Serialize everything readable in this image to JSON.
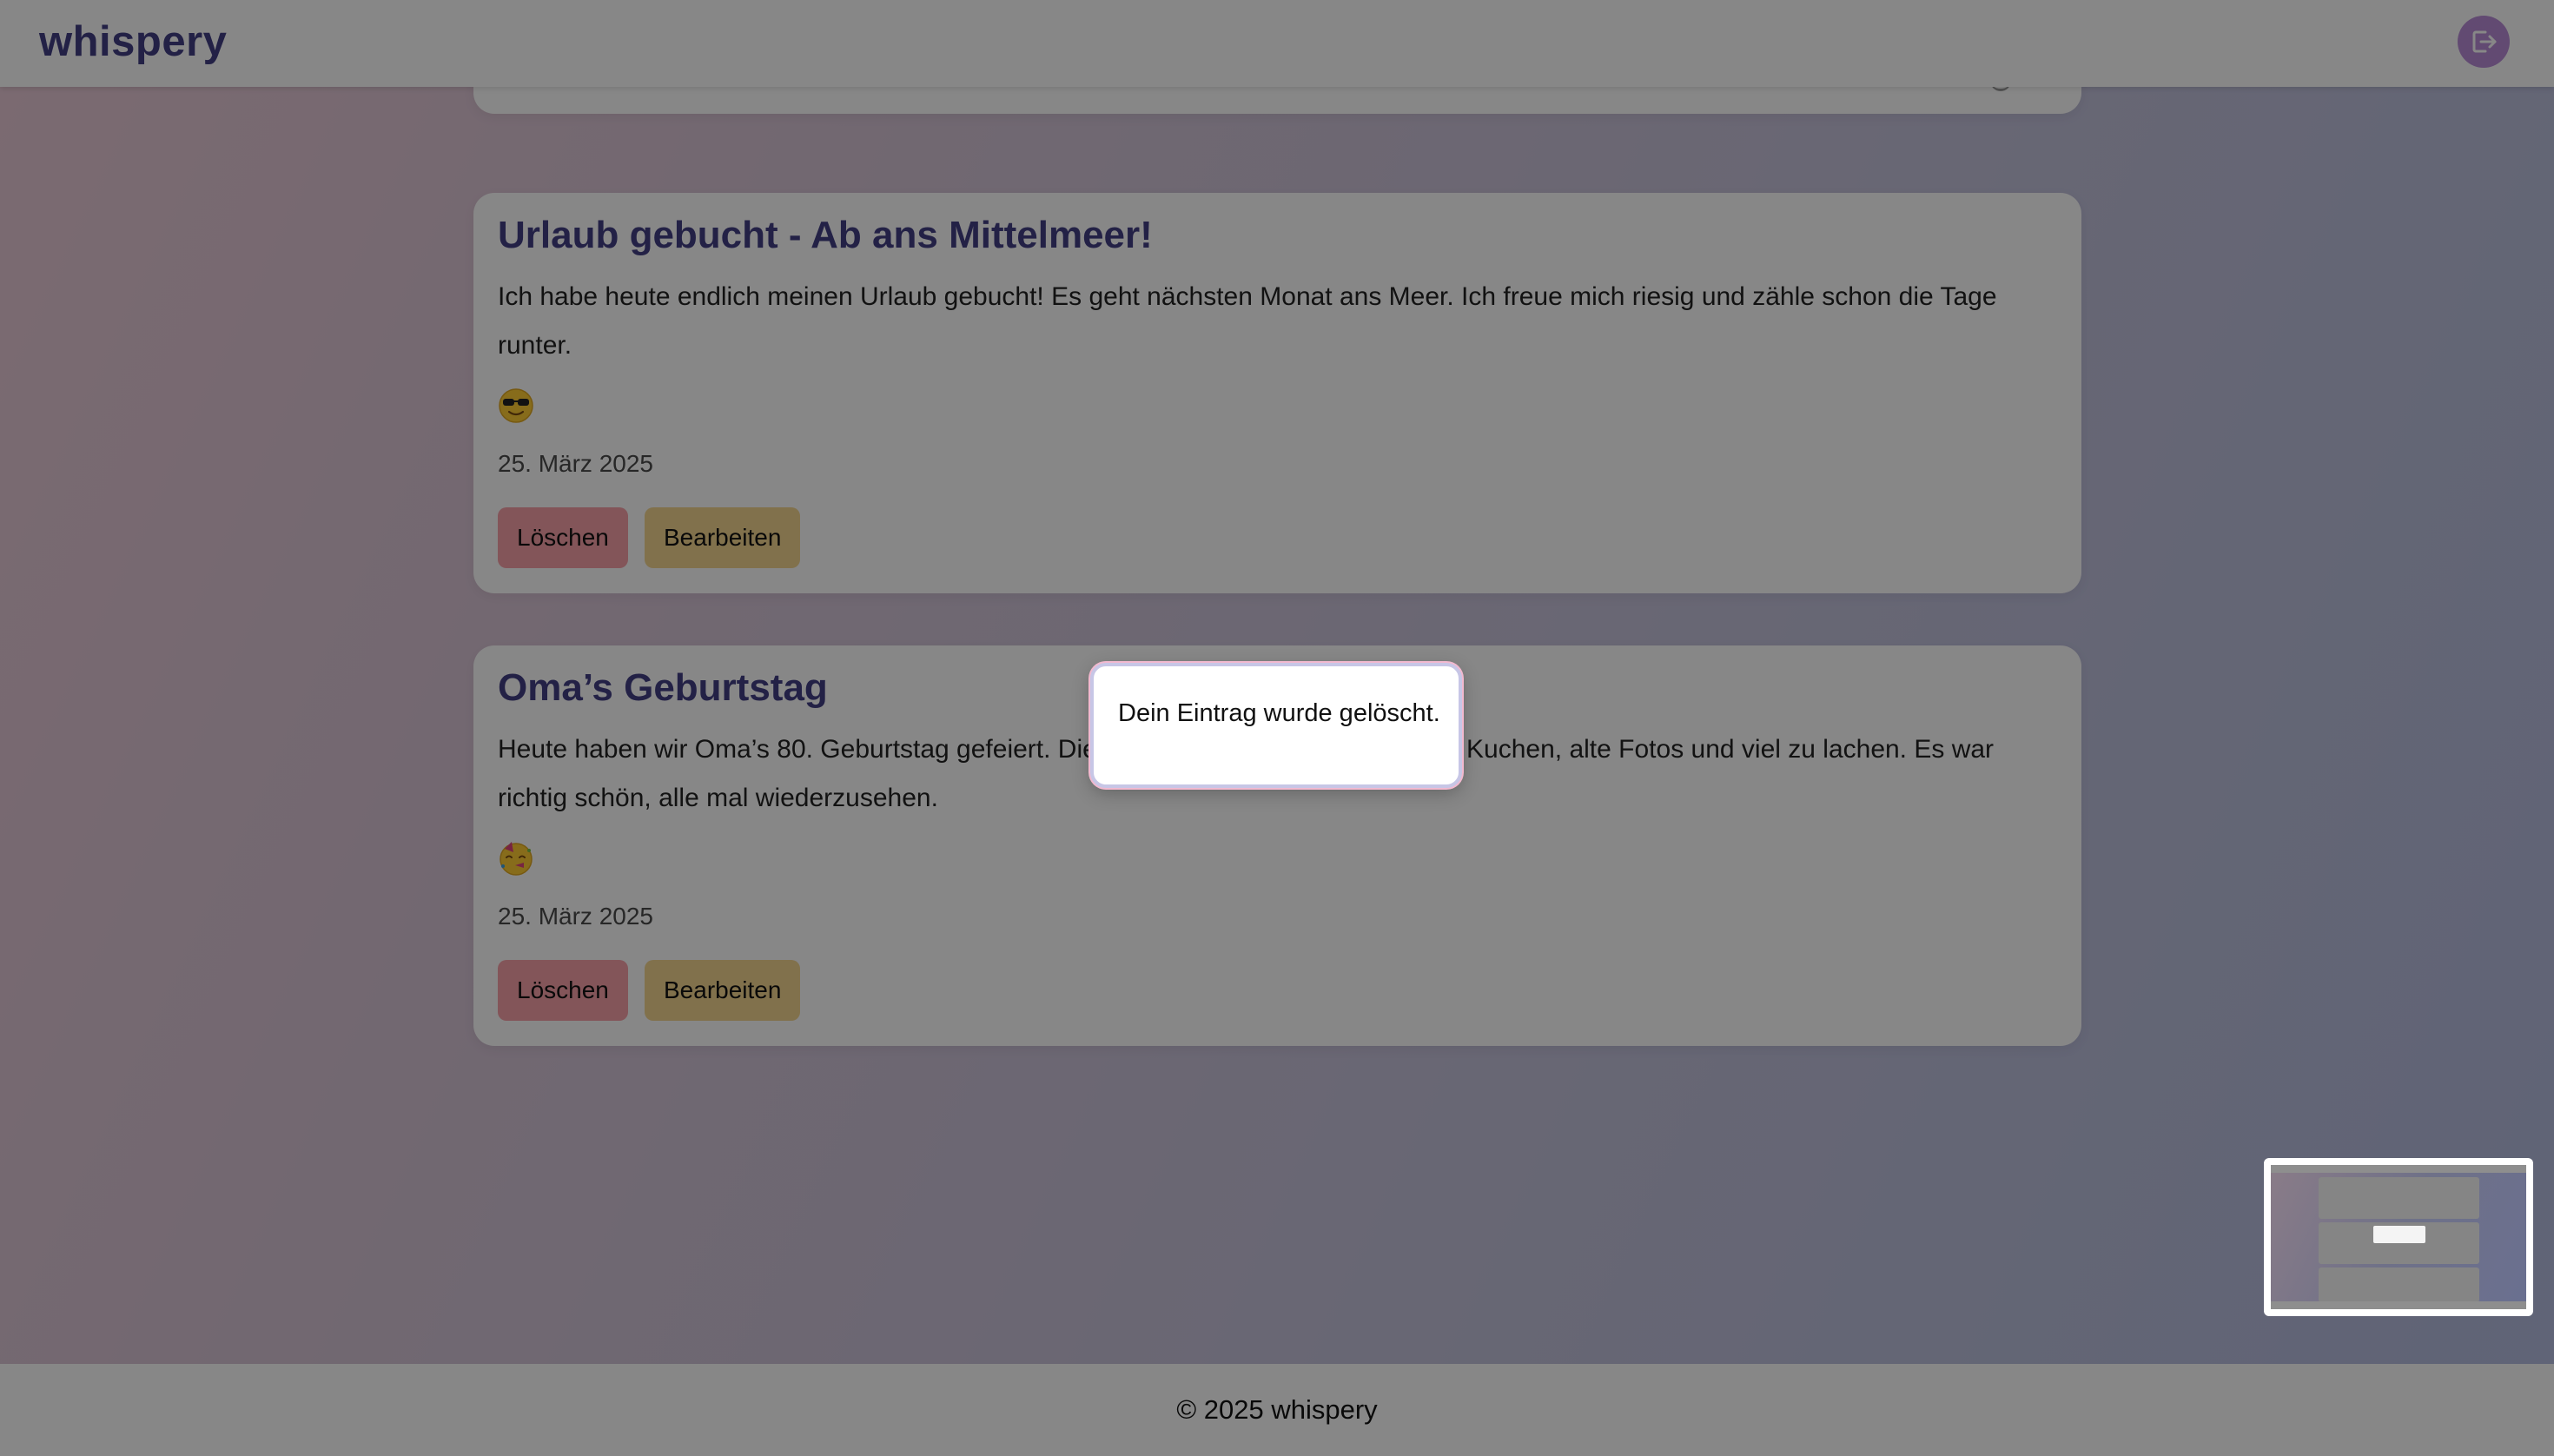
{
  "header": {
    "logo": "whispery",
    "logout_icon": "logout-icon"
  },
  "entries": [
    {
      "title": "Urlaub gebucht - Ab ans Mittelmeer!",
      "text": "Ich habe heute endlich meinen Urlaub gebucht! Es geht nächsten Monat ans Meer. Ich freue mich riesig und zähle schon die Tage runter.",
      "emoji": "sunglasses-face-emoji",
      "date": "25. März 2025",
      "delete_label": "Löschen",
      "edit_label": "Bearbeiten"
    },
    {
      "title": "Oma’s Geburtstag",
      "text": "Heute haben wir Oma’s 80. Geburtstag gefeiert. Die ganze Familie war da – es gab Kuchen, alte Fotos und viel zu lachen. Es war richtig schön, alle mal wiederzusehen.",
      "emoji": "partying-face-emoji",
      "date": "25. März 2025",
      "delete_label": "Löschen",
      "edit_label": "Bearbeiten"
    }
  ],
  "toast": {
    "message": "Dein Eintrag wurde gelöscht."
  },
  "footer": {
    "copyright": "© 2025 whispery"
  },
  "colors": {
    "brand": "#433f84",
    "delete_button": "#f8a0a8",
    "edit_button": "#f4d690",
    "logout_button": "#b98cd8"
  }
}
